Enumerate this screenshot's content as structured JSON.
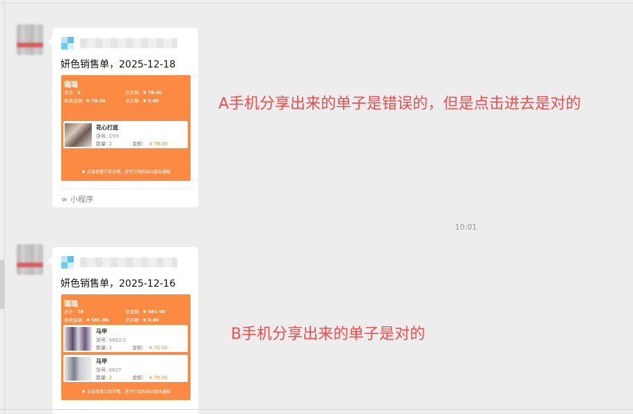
{
  "time_separator": "10:01",
  "annotations": {
    "a": "A手机分享出来的单子是错误的，但是点击进去是对的",
    "b": "B手机分享出来的单子是对的"
  },
  "colors": {
    "card": "#fd8a42",
    "annotation": "#ef4e4e",
    "amount": "#f08a2c"
  },
  "messages": [
    {
      "title": "妍色销售单，2025-12-18",
      "footer_icon": "link-icon",
      "footer": "小程序",
      "card": {
        "shop": "璐璐",
        "total_label": "总计:",
        "total": "2",
        "total_amount_label": "总金额:",
        "total_amount": "¥ 78.00",
        "received_label": "收款金额:",
        "received": "¥ 78.00",
        "discount_label": "总余额:",
        "discount": "¥ 0.00",
        "items": [
          {
            "name": "花心打底",
            "code_label": "货号:",
            "code": "D99",
            "qty_label": "数量:",
            "qty": "2",
            "amount_label": "金额:",
            "amount": "¥ 78.00"
          }
        ],
        "notice": "点击查看订单详情，还可订阅后自动接收通知"
      }
    },
    {
      "title": "妍色销售单，2025-12-16",
      "card": {
        "shop": "璐璐",
        "total_label": "总计:",
        "total": "18",
        "total_amount_label": "总金额:",
        "total_amount": "¥ 581.00",
        "received_label": "收款金额:",
        "received": "¥ 581.00",
        "discount_label": "总余额:",
        "discount": "¥ 0.00",
        "items": [
          {
            "name": "马甲",
            "code_label": "货号:",
            "code": "6682-2",
            "qty_label": "数量:",
            "qty": "2",
            "amount_label": "金额:",
            "amount": "¥ 70.00"
          },
          {
            "name": "马甲",
            "code_label": "货号:",
            "code": "6607",
            "qty_label": "数量:",
            "qty": "2",
            "amount_label": "金额:",
            "amount": "¥ 70.00"
          }
        ],
        "notice": "点击查看订单详情，还可订阅后自动接收通知"
      }
    }
  ]
}
